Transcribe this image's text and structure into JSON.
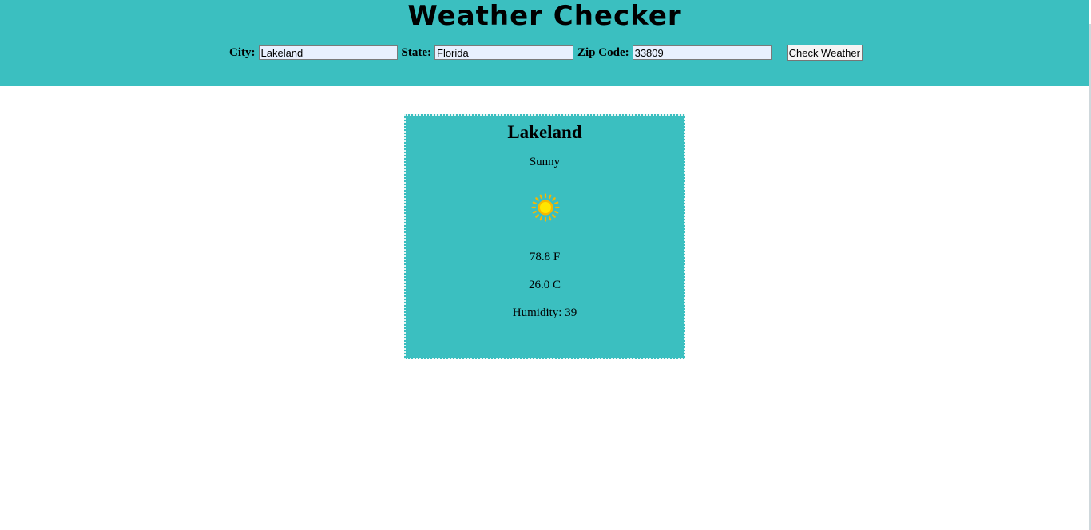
{
  "header": {
    "title": "Weather Checker",
    "city_label": "City:",
    "city_value": "Lakeland",
    "state_label": "State:",
    "state_value": "Florida",
    "zip_label": "Zip Code:",
    "zip_value": "33809",
    "check_button_label": "Check Weather"
  },
  "card": {
    "city": "Lakeland",
    "condition": "Sunny",
    "condition_icon": "sun-icon",
    "temp_f": "78.8 F",
    "temp_c": "26.0 C",
    "humidity": "Humidity: 39"
  },
  "colors": {
    "accent": "#3bbfc0",
    "input_background": "#e8f0fe",
    "sun_core": "#ffe600",
    "sun_rays": "#f6b800"
  }
}
